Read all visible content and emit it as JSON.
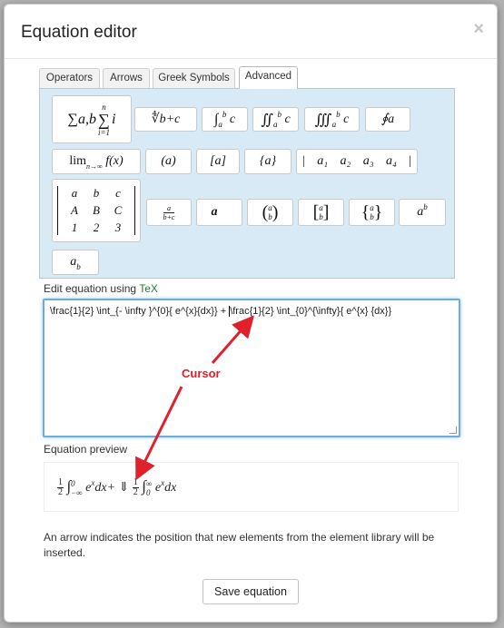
{
  "dialog": {
    "title": "Equation editor",
    "close": "×"
  },
  "tabs": [
    "Operators",
    "Arrows",
    "Greek Symbols",
    "Advanced"
  ],
  "palette": {
    "sum": "∑a,b",
    "sum_upper": "n",
    "sum_lower": "i=1",
    "sum_var": "i",
    "root": "∜b+c",
    "int1": "∫",
    "int1_body": "c",
    "int2": "∬",
    "int2_body": "c",
    "int3": "∭",
    "int3_body": "c",
    "oint": "∮a",
    "lim": "lim",
    "lim_sub": "n→∞",
    "lim_f": "f(x)",
    "paren": "(a)",
    "bracket": "[a]",
    "brace": "{a}",
    "vector_elems": [
      "a₁",
      "a₂",
      "a₃",
      "a₄"
    ],
    "matrix_rows": [
      [
        "a",
        "b",
        "c"
      ],
      [
        "A",
        "B",
        "C"
      ],
      [
        "1",
        "2",
        "3"
      ]
    ],
    "frac_num": "a",
    "frac_den": "b+c",
    "vec": "a⃗",
    "binom_p": "(a b)",
    "binom_b": "[a b]",
    "binom_c": "{a b}",
    "pow_base": "a",
    "pow_exp": "b",
    "sub_base": "a",
    "sub_idx": "b"
  },
  "edit_label_prefix": "Edit equation using ",
  "edit_label_tex": "TeX",
  "editor_text_before": "\\frac{1}{2} \\int_{- \\infty }^{0}{ e^{x}{dx}} + ",
  "editor_text_after": "\\frac{1}{2} \\int_{0}^{\\infty}{ e^{x} {dx}}",
  "annotation": "Cursor",
  "preview_label": "Equation preview",
  "preview": {
    "half": "1",
    "two": "2",
    "int_upper1": "0",
    "int_lower1": "−∞",
    "body1": "e",
    "exp1": "x",
    "dx1": "dx+",
    "cursor": "⇓",
    "int_upper2": "∞",
    "int_lower2": "0",
    "body2": "e",
    "exp2": "x",
    "dx2": "dx"
  },
  "note": "An arrow indicates the position that new elements from the element library will be inserted.",
  "save_label": "Save equation",
  "colors": {
    "accent": "#e0202a",
    "panel": "#d9eaf7",
    "tex": "#2a7a3a"
  }
}
